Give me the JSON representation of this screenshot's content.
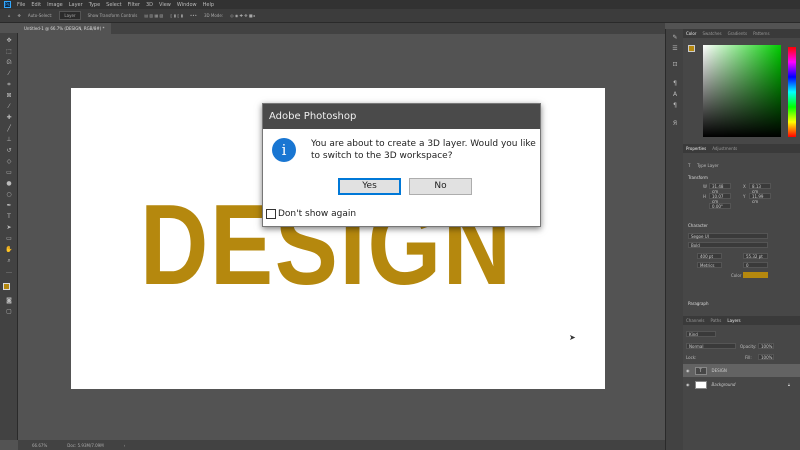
{
  "menu": {
    "items": [
      "File",
      "Edit",
      "Image",
      "Layer",
      "Type",
      "Select",
      "Filter",
      "3D",
      "View",
      "Window",
      "Help"
    ]
  },
  "options": {
    "auto_select": "Auto-Select:",
    "layer_select": "Layer",
    "show_transform": "Show Transform Controls",
    "mode_3d": "3D Mode:"
  },
  "document": {
    "tab_title": "Untitled-1 @ 66.7% (DESIGN, RGB/8#) *",
    "canvas_text": "DESIGN",
    "text_color": "#b5880e"
  },
  "status": {
    "zoom": "66.67%",
    "doc_size": "Doc: 5.93M/7.09M"
  },
  "dialog": {
    "title": "Adobe Photoshop",
    "message": "You are about to create a 3D layer.  Would you like to switch to the 3D workspace?",
    "yes": "Yes",
    "no": "No",
    "dont_show": "Don't show again",
    "dont_show_checked": false
  },
  "color_panel": {
    "tabs": [
      "Color",
      "Swatches",
      "Gradients",
      "Patterns"
    ],
    "foreground": "#b5880e"
  },
  "properties": {
    "tabs": [
      "Properties",
      "Adjustments"
    ],
    "kind": "Type Layer",
    "transform_header": "Transform",
    "w": "31.48 cm",
    "x": "8.13 cm",
    "h": "10.07 cm",
    "y": "11.99 cm",
    "angle": "0.00°",
    "character_header": "Character",
    "font": "Segoe UI",
    "style": "Bold",
    "size": "400 pt",
    "leading": "55.32 pt",
    "kerning": "Metrics",
    "tracking": "0",
    "color_label": "Color",
    "paragraph_header": "Paragraph"
  },
  "layers_panel": {
    "tabs": [
      "Channels",
      "Paths",
      "Layers"
    ],
    "filter": "Kind",
    "blend": "Normal",
    "opacity_label": "Opacity:",
    "opacity": "100%",
    "lock_label": "Lock:",
    "fill_label": "Fill:",
    "fill": "100%",
    "layers": [
      {
        "name": "DESIGN",
        "type": "text",
        "selected": true
      },
      {
        "name": "Background",
        "type": "image",
        "selected": false
      }
    ]
  }
}
